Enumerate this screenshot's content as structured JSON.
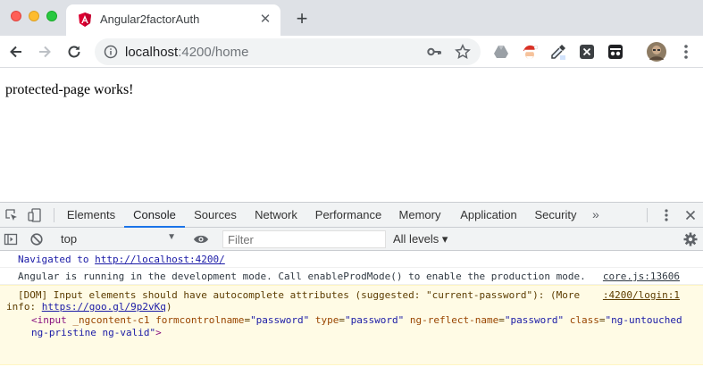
{
  "browser": {
    "tab": {
      "title": "Angular2factorAuth",
      "close_symbol": "✕"
    },
    "new_tab_symbol": "+",
    "address": {
      "host": "localhost",
      "port_path": ":4200/home"
    },
    "extensions": [
      "google-drive-icon",
      "santa-extension-icon",
      "eyedropper-icon",
      "x-extension-icon",
      "incognito-extension-icon",
      "profile-avatar"
    ]
  },
  "page": {
    "text": "protected-page works!"
  },
  "devtools": {
    "tabs": [
      "Elements",
      "Console",
      "Sources",
      "Network",
      "Performance",
      "Memory",
      "Application",
      "Security"
    ],
    "active_tab": "Console",
    "more_symbol": "»",
    "context": "top",
    "filter_placeholder": "Filter",
    "levels": "All levels ▾",
    "console": {
      "nav_prefix": "Navigated to ",
      "nav_url": "http://localhost:4200/",
      "dev_mode_msg": "Angular is running in the development mode. Call enableProdMode() to enable the production mode.",
      "dev_mode_src": "core.js:13606",
      "warn_line1": "[DOM] Input elements should have autocomplete attributes (suggested: \"current-password\"): (More",
      "warn_src": ":4200/login:1",
      "warn_info_prefix": "info: ",
      "warn_info_link": "https://goo.gl/9p2vKq",
      "warn_info_suffix": ")",
      "el_open": "<input",
      "el_attr1": "_ngcontent-c1",
      "el_attr2": "formcontrolname",
      "el_val2": "\"password\"",
      "el_attr3": "type",
      "el_val3": "\"password\"",
      "el_attr4": "ng-reflect-name",
      "el_val4": "\"password\"",
      "el_attr5": "class",
      "el_val5a": "\"ng-untouched",
      "el_val5b": "ng-pristine ng-valid\"",
      "el_close": ">",
      "prompt_symbol": "›"
    }
  },
  "colors": {
    "accent": "#1a73e8",
    "angular_red": "#dd0031",
    "warning_bg": "#fffbe5"
  }
}
